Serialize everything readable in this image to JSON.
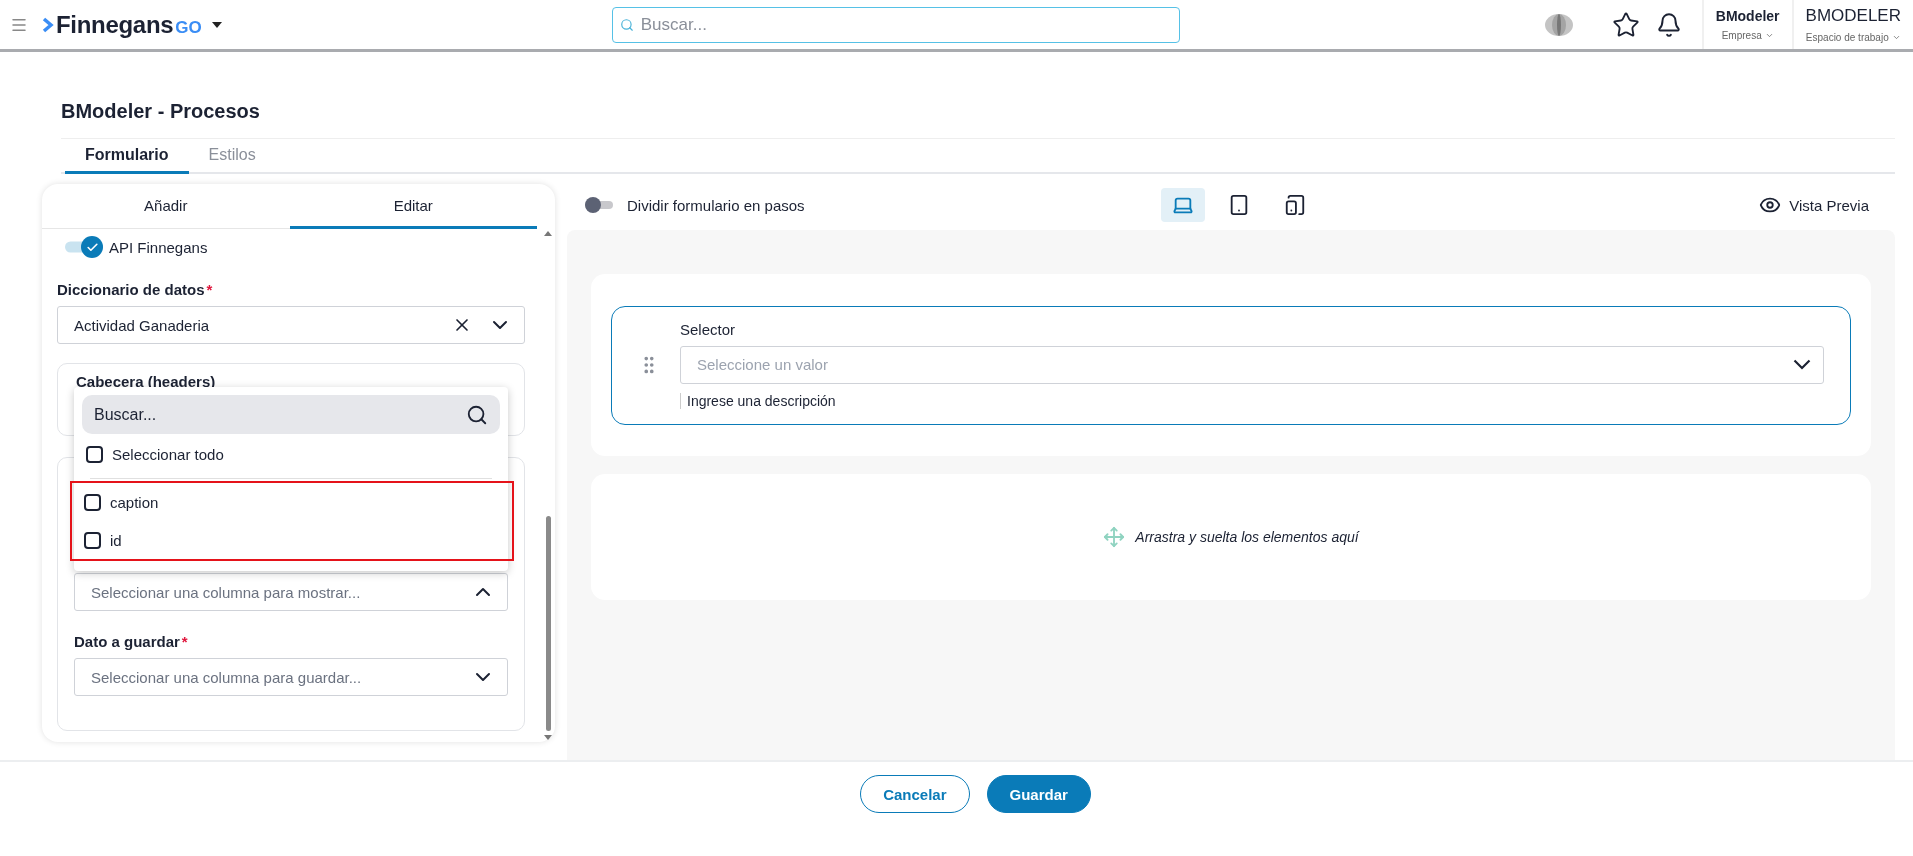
{
  "topbar": {
    "logo_text": "Finnegans",
    "logo_suffix": "GO",
    "search_placeholder": "Buscar...",
    "company": {
      "name": "BModeler",
      "label": "Empresa"
    },
    "workspace": {
      "name": "BMODELER",
      "label": "Espacio de trabajo"
    }
  },
  "page_title": "BModeler - Procesos",
  "tabs": [
    {
      "label": "Formulario",
      "selected": true
    },
    {
      "label": "Estilos",
      "selected": false
    }
  ],
  "left_panel": {
    "tabs": [
      {
        "label": "Añadir",
        "selected": false
      },
      {
        "label": "Editar",
        "selected": true
      }
    ],
    "api_toggle": {
      "label": "API Finnegans",
      "on": true
    },
    "dictionary": {
      "label": "Diccionario de datos",
      "required_mark": "*",
      "value": "Actividad Ganaderia"
    },
    "headers_card": {
      "title": "Cabecera (headers)"
    },
    "display_select": {
      "placeholder": "Seleccionar una columna para mostrar...",
      "expanded": true
    },
    "save_field": {
      "label": "Dato a guardar",
      "required_mark": "*",
      "placeholder": "Seleccionar una columna para guardar...",
      "expanded": false
    },
    "dropdown": {
      "search_placeholder": "Buscar...",
      "select_all": {
        "label": "Seleccionar todo",
        "checked": false
      },
      "options_highlighted": true,
      "options": [
        {
          "label": "caption",
          "checked": false
        },
        {
          "label": "id",
          "checked": false
        }
      ]
    }
  },
  "toolbar": {
    "steps_toggle": {
      "label": "Dividir formulario en pasos",
      "on": false
    },
    "devices": [
      {
        "kind": "desktop",
        "selected": true
      },
      {
        "kind": "tablet",
        "selected": false
      },
      {
        "kind": "mobile",
        "selected": false
      }
    ],
    "preview": "Vista Previa"
  },
  "canvas": {
    "selector": {
      "label": "Selector",
      "placeholder": "Seleccione un valor",
      "description": "Ingrese una descripción"
    },
    "drop_hint": "Arrastra y suelta los elementos aquí"
  },
  "footer": {
    "buttons": [
      {
        "label": "Cancelar",
        "kind": "secondary"
      },
      {
        "label": "Guardar",
        "kind": "primary"
      }
    ]
  }
}
